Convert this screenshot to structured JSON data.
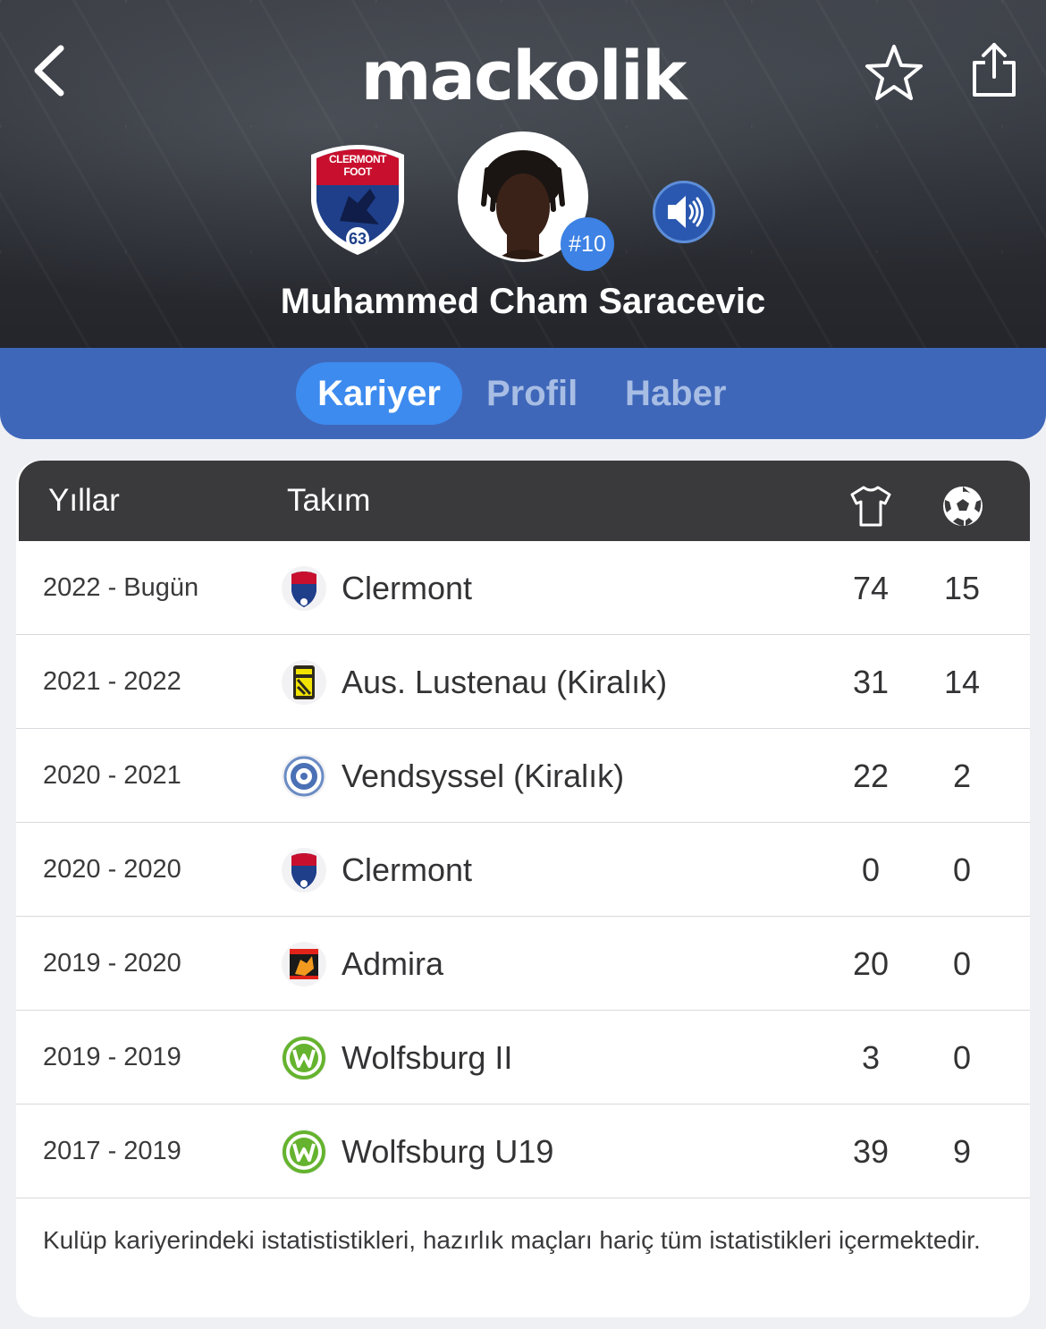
{
  "header": {
    "app_logo": "mackolik",
    "player_name": "Muhammed Cham Saracevic",
    "shirt_number": "#10",
    "club_crest_text": "CLERMONT FOOT",
    "club_crest_number": "63",
    "icons": {
      "back": "chevron-left-icon",
      "favorite": "star-outline-icon",
      "share": "share-icon",
      "sound": "speaker-icon"
    }
  },
  "tabs": [
    {
      "label": "Kariyer",
      "active": true
    },
    {
      "label": "Profil",
      "active": false
    },
    {
      "label": "Haber",
      "active": false
    }
  ],
  "table": {
    "headers": {
      "years": "Yıllar",
      "team": "Takım",
      "apps_icon": "shirt-icon",
      "goals_icon": "football-icon"
    },
    "rows": [
      {
        "years": "2022 - Bugün",
        "team": "Clermont",
        "apps": "74",
        "goals": "15",
        "crest": "clermont"
      },
      {
        "years": "2021 - 2022",
        "team": "Aus. Lustenau (Kiralık)",
        "apps": "31",
        "goals": "14",
        "crest": "lustenau"
      },
      {
        "years": "2020 - 2021",
        "team": "Vendsyssel (Kiralık)",
        "apps": "22",
        "goals": "2",
        "crest": "vendsyssel"
      },
      {
        "years": "2020 - 2020",
        "team": "Clermont",
        "apps": "0",
        "goals": "0",
        "crest": "clermont"
      },
      {
        "years": "2019 - 2020",
        "team": "Admira",
        "apps": "20",
        "goals": "0",
        "crest": "admira"
      },
      {
        "years": "2019 - 2019",
        "team": "Wolfsburg II",
        "apps": "3",
        "goals": "0",
        "crest": "wolfsburg"
      },
      {
        "years": "2017 - 2019",
        "team": "Wolfsburg U19",
        "apps": "39",
        "goals": "9",
        "crest": "wolfsburg"
      }
    ],
    "footnote": "Kulüp kariyerindeki istatististikleri, hazırlık maçları hariç tüm istatistikleri içermektedir."
  },
  "colors": {
    "tabs_bar": "#3f67b9",
    "tab_active": "#3d8bef",
    "table_header": "#3a3a3c",
    "number_badge": "#3d82e4"
  }
}
